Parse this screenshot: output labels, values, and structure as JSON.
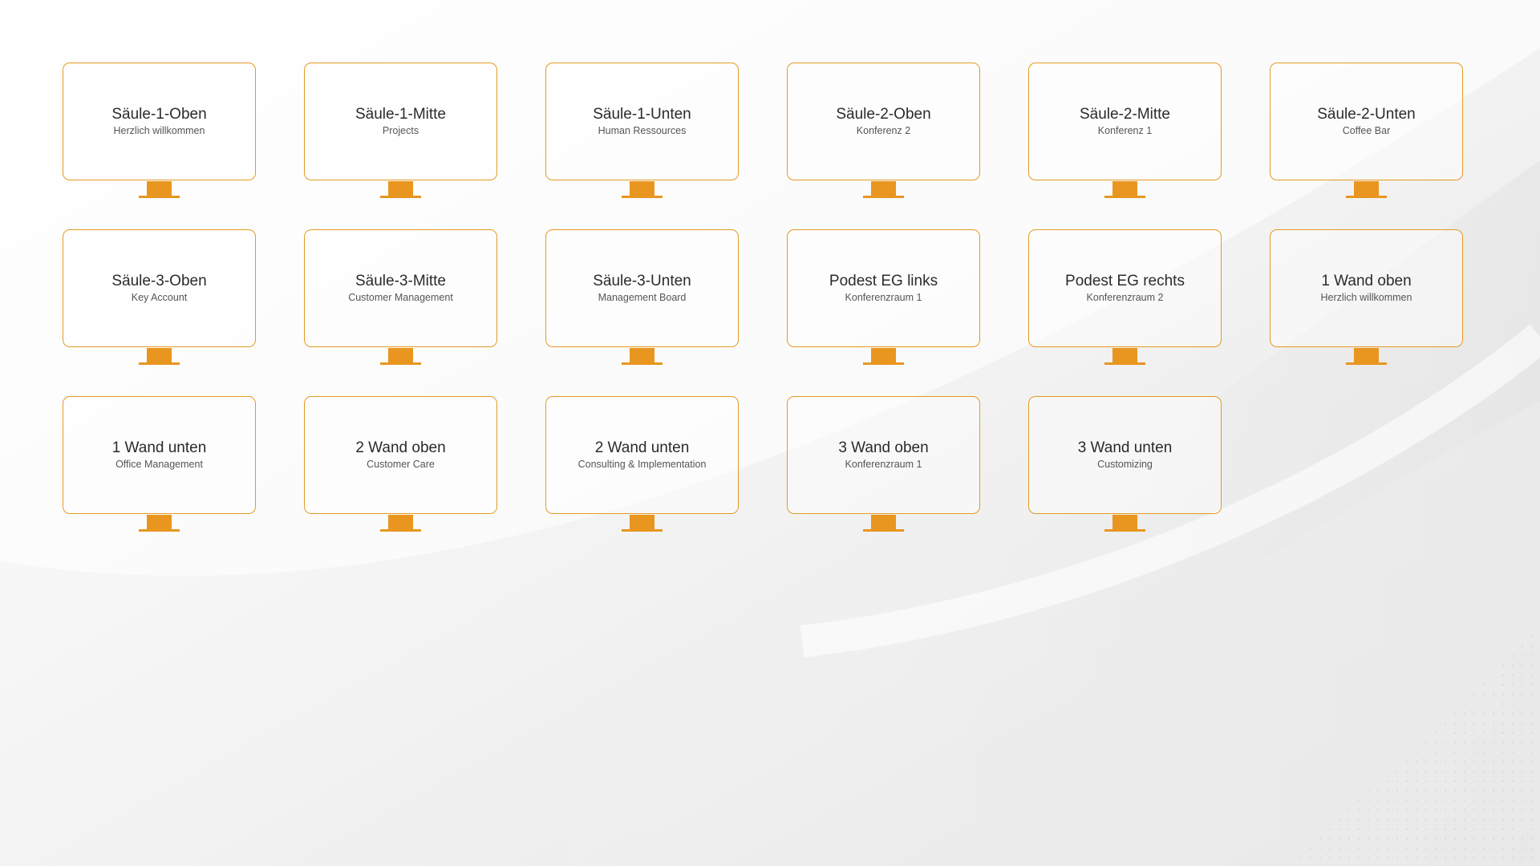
{
  "displays": [
    {
      "title": "Säule-1-Oben",
      "subtitle": "Herzlich willkommen"
    },
    {
      "title": "Säule-1-Mitte",
      "subtitle": "Projects"
    },
    {
      "title": "Säule-1-Unten",
      "subtitle": "Human Ressources"
    },
    {
      "title": "Säule-2-Oben",
      "subtitle": "Konferenz 2"
    },
    {
      "title": "Säule-2-Mitte",
      "subtitle": "Konferenz 1"
    },
    {
      "title": "Säule-2-Unten",
      "subtitle": "Coffee Bar"
    },
    {
      "title": "Säule-3-Oben",
      "subtitle": "Key Account"
    },
    {
      "title": "Säule-3-Mitte",
      "subtitle": "Customer Management"
    },
    {
      "title": "Säule-3-Unten",
      "subtitle": "Management Board"
    },
    {
      "title": "Podest EG links",
      "subtitle": "Konferenzraum 1"
    },
    {
      "title": "Podest EG rechts",
      "subtitle": "Konferenzraum 2"
    },
    {
      "title": "1 Wand oben",
      "subtitle": "Herzlich willkommen"
    },
    {
      "title": "1 Wand unten",
      "subtitle": "Office Management"
    },
    {
      "title": "2 Wand oben",
      "subtitle": "Customer Care"
    },
    {
      "title": "2 Wand unten",
      "subtitle": "Consulting & Implementation"
    },
    {
      "title": "3 Wand oben",
      "subtitle": "Konferenzraum 1"
    },
    {
      "title": "3 Wand unten",
      "subtitle": "Customizing"
    }
  ],
  "colors": {
    "accent": "#e8961f",
    "border": "#e59a23",
    "background": "#fbfbfb"
  },
  "icons": {
    "display": "monitor-icon"
  }
}
